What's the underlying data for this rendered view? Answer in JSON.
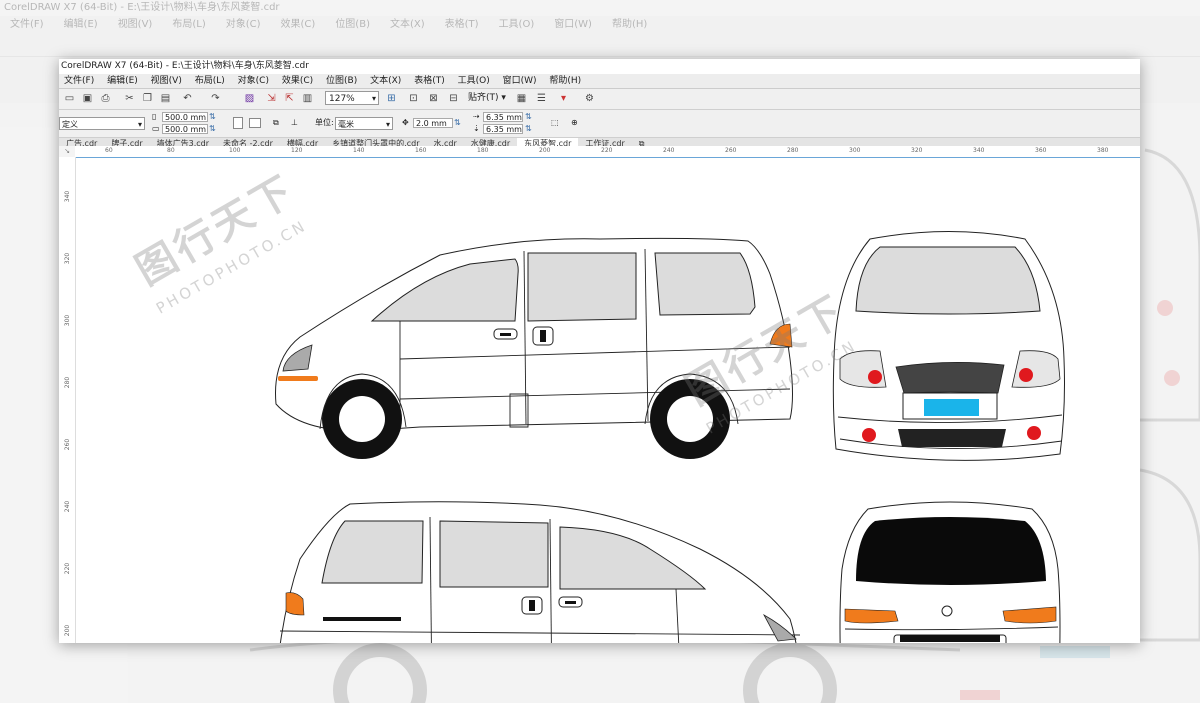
{
  "window": {
    "title": "CorelDRAW X7 (64-Bit) - E:\\王设计\\物料\\车身\\东风菱智.cdr",
    "bg_title": "CorelDRAW X7 (64-Bit) - E:\\王设计\\物料\\车身\\东风菱智.cdr"
  },
  "menu": [
    "文件(F)",
    "编辑(E)",
    "视图(V)",
    "布局(L)",
    "对象(C)",
    "效果(C)",
    "位图(B)",
    "文本(X)",
    "表格(T)",
    "工具(O)",
    "窗口(W)",
    "帮助(H)"
  ],
  "toolbar": {
    "zoom": "127%",
    "snap_label": "贴齐(T)"
  },
  "propbar": {
    "page_preset": "定义",
    "width": "500.0 mm",
    "height": "500.0 mm",
    "unit_label": "单位:",
    "unit": "毫米",
    "nudge": "2.0 mm",
    "dup_x": "6.35 mm",
    "dup_y": "6.35 mm"
  },
  "tabs": [
    "广告.cdr",
    "牌子.cdr",
    "墙体广告3.cdr",
    "未命名 -2.cdr",
    "横幅.cdr",
    "乡镇道整门头罩中的.cdr",
    "水.cdr",
    "水健康.cdr",
    "东风菱智.cdr",
    "工作证.cdr"
  ],
  "active_tab_index": 8,
  "ruler": {
    "unit_corner": "毫米",
    "top_ticks": [
      "60",
      "80",
      "100",
      "120",
      "140",
      "160",
      "180",
      "200",
      "220",
      "240",
      "260",
      "280",
      "300",
      "320",
      "340",
      "360",
      "380"
    ],
    "left_ticks": [
      "340",
      "320",
      "300",
      "280",
      "260",
      "240",
      "220",
      "200"
    ]
  },
  "watermark": {
    "logo_text": "图行天下",
    "brand_text": "PHOTOPHOTO.CN"
  },
  "colors": {
    "window_glass": "#d9d9d9",
    "tire": "#111111",
    "turn_signal": "#f07b1c",
    "brake_light": "#e0191e",
    "plate": "#1ab4ea",
    "ruler_accent": "#6aa6d8"
  }
}
